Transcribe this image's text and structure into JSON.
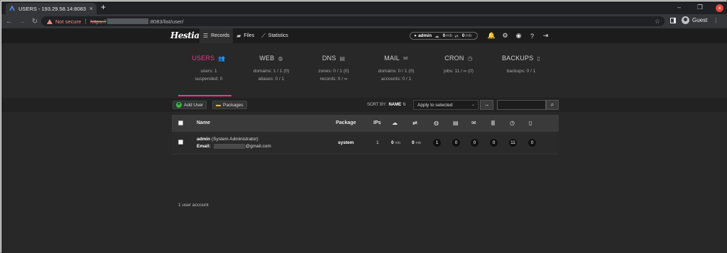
{
  "browser": {
    "tab_title": "USERS - 193.29.58.14:8083",
    "new_tab": "+",
    "not_secure": "Not secure",
    "url_scheme": "https://",
    "url_rest": ":8083/list/user/",
    "profile": "Guest"
  },
  "app": {
    "logo": "Hestia",
    "nav": [
      {
        "label": "Records",
        "icon": "list-icon"
      },
      {
        "label": "Files",
        "icon": "folder-icon"
      },
      {
        "label": "Statistics",
        "icon": "chart-icon"
      }
    ],
    "user": {
      "name": "admin",
      "disk": "0",
      "disk_unit": "mb",
      "bandwidth": "0",
      "bandwidth_unit": "mb"
    }
  },
  "stats": [
    {
      "title": "USERS",
      "l1": "users: 1",
      "l2": "suspended: 0"
    },
    {
      "title": "WEB",
      "l1": "domains: 1 / 1 (0)",
      "l2": "aliases: 0 / 1"
    },
    {
      "title": "DNS",
      "l1": "zones: 0 / 1 (0)",
      "l2": "records: 0 / ∞"
    },
    {
      "title": "MAIL",
      "l1": "domains: 0 / 1 (0)",
      "l2": "accounts: 0 / 1"
    },
    {
      "title": "CRON",
      "l1": "jobs: 11 / ∞ (0)",
      "l2": ""
    },
    {
      "title": "BACKUPS",
      "l1": "backups: 0 / 1",
      "l2": ""
    }
  ],
  "actions": {
    "add_user": "Add User",
    "packages": "Packages",
    "sort_by": "SORT BY:",
    "sort_field": "NAME",
    "bulk_select": "Apply to selected"
  },
  "table": {
    "headers": {
      "name": "Name",
      "package": "Package",
      "ips": "IPs"
    },
    "rows": [
      {
        "name": "admin",
        "role": "(System Administrator)",
        "email_label": "Email:",
        "email_domain": "@gmail.com",
        "package": "system",
        "ips": "1",
        "disk": "0",
        "disk_unit": "mb",
        "bandwidth": "0",
        "bandwidth_unit": "mb",
        "web": "1",
        "dns": "0",
        "mail": "0",
        "db": "0",
        "cron": "11",
        "backups": "0"
      }
    ]
  },
  "footer": {
    "count": "1 user account"
  }
}
